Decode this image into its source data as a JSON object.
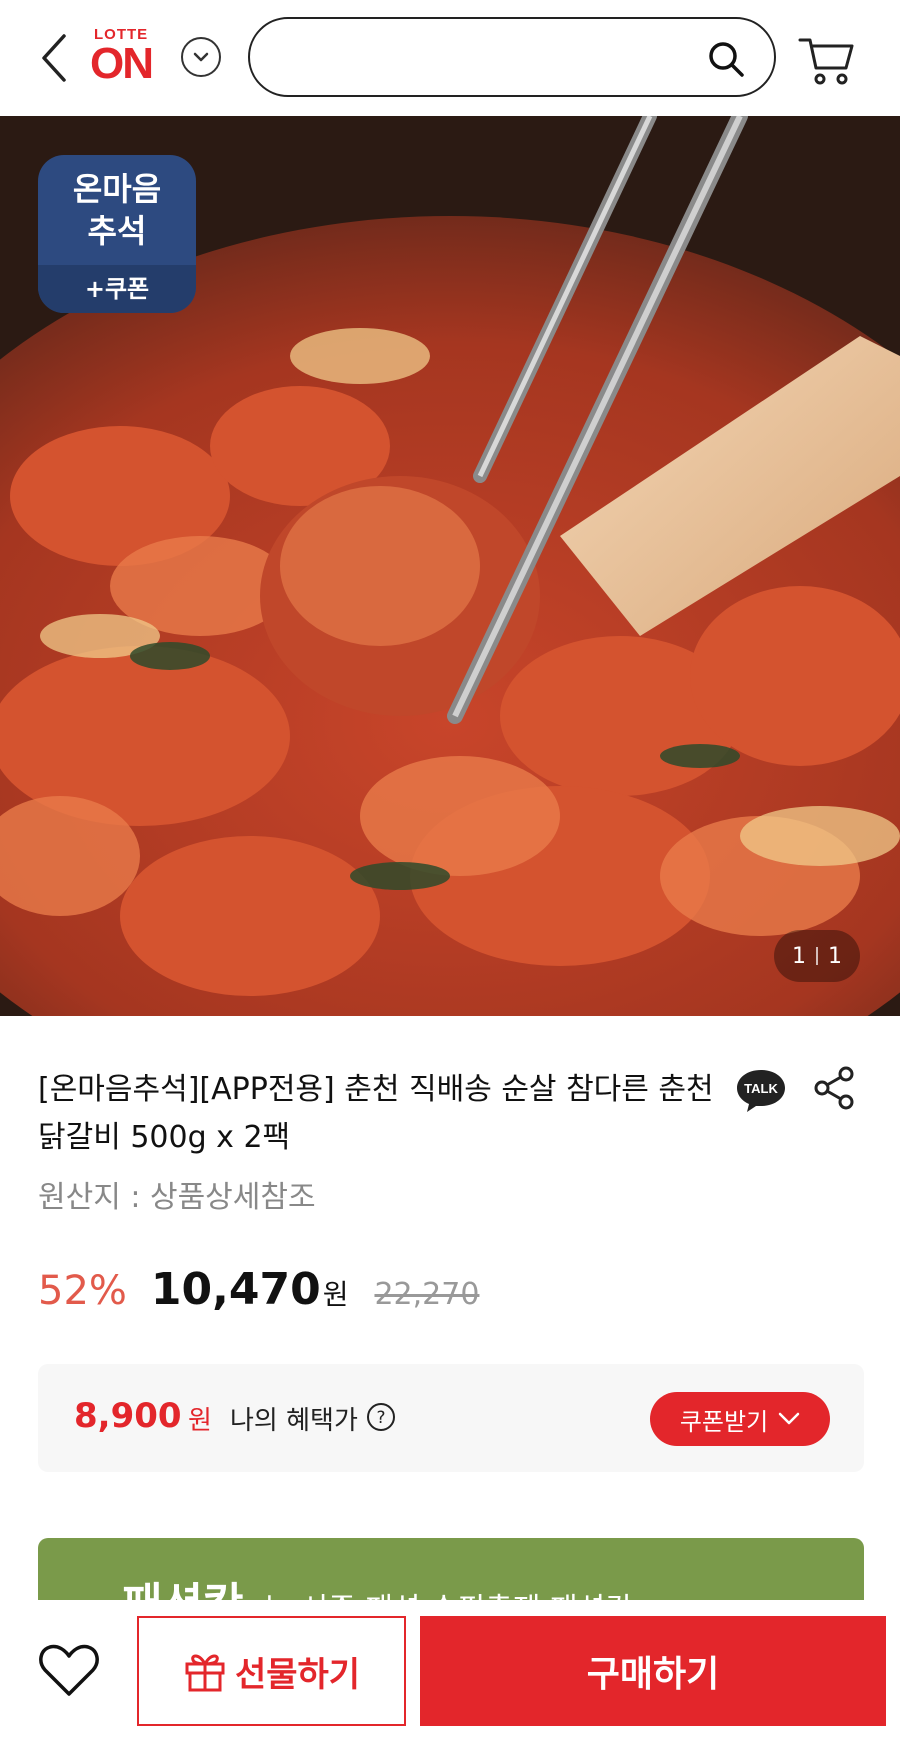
{
  "header": {
    "logo_top": "LOTTE",
    "logo_main": "ON",
    "search_placeholder": ""
  },
  "hero": {
    "promo_badge": {
      "line1": "온마음",
      "line2": "추석",
      "coupon": "+쿠폰"
    },
    "counter": {
      "current": "1",
      "total": "1"
    }
  },
  "product": {
    "title": "[온마음추석][APP전용] 춘천 직배송 순살 참다른 춘천닭갈비 500g x 2팩",
    "origin": "원산지 : 상품상세참조",
    "discount": "52%",
    "price": "10,470",
    "price_unit": "원",
    "original_price": "22,270"
  },
  "benefit": {
    "price": "8,900",
    "unit": "원",
    "label": "나의 혜택가",
    "coupon_button": "쿠폰받기"
  },
  "promo_banner": {
    "title": "패션칸",
    "subtitle": "누 시즌 패션 슈핑축제 패션칸 >"
  },
  "bottom_bar": {
    "gift_label": "선물하기",
    "buy_label": "구매하기"
  },
  "colors": {
    "brand_red": "#e3262b",
    "discount_red": "#e25a4b",
    "badge_blue": "#2d4a80",
    "banner_green": "#7a9a4a"
  },
  "icons": [
    "back-icon",
    "chevron-down-icon",
    "search-icon",
    "cart-icon",
    "talk-icon",
    "share-icon",
    "help-icon",
    "heart-icon",
    "gift-icon"
  ]
}
